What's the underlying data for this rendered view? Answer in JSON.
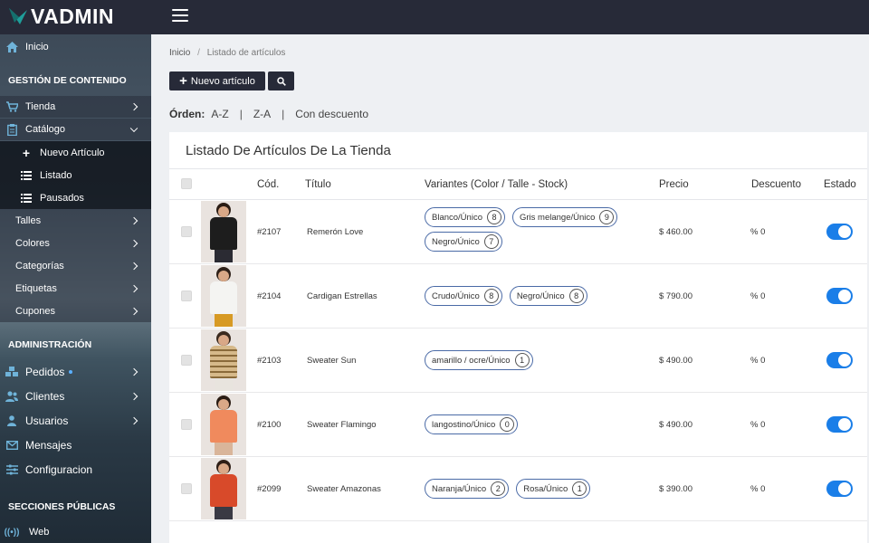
{
  "brand": {
    "name": "VADMIN",
    "accent": "#1f9e9a"
  },
  "topbar": {
    "menu_icon": "hamburger-icon"
  },
  "sidebar": {
    "inicio": "Inicio",
    "sections": {
      "contenido": "GESTIÓN DE CONTENIDO",
      "administracion": "ADMINISTRACIÓN",
      "publicas": "SECCIONES PÚBLICAS"
    },
    "tienda": "Tienda",
    "catalogo": "Catálogo",
    "catalogo_sub": [
      "Nuevo Artículo",
      "Listado",
      "Pausados"
    ],
    "tienda_items": [
      "Talles",
      "Colores",
      "Categorías",
      "Etiquetas",
      "Cupones"
    ],
    "admin_items": [
      "Pedidos",
      "Clientes",
      "Usuarios",
      "Mensajes",
      "Configuracion"
    ],
    "web": "Web"
  },
  "breadcrumb": {
    "home": "Inicio",
    "separator": "/",
    "current": "Listado de artículos"
  },
  "toolbar": {
    "new_label": "Nuevo artículo"
  },
  "order": {
    "label": "Órden:",
    "options": [
      "A-Z",
      "Z-A",
      "Con descuento"
    ]
  },
  "card": {
    "title": "Listado De Artículos De La Tienda"
  },
  "table": {
    "headers": [
      "Cód.",
      "Título",
      "Variantes (Color / Talle - Stock)",
      "Precio",
      "Descuento",
      "Estado"
    ],
    "rows": [
      {
        "code": "#2107",
        "title": "Remerón Love",
        "variants": [
          [
            "Blanco/Único",
            "8"
          ],
          [
            "Gris melange/Único",
            "9"
          ],
          [
            "Negro/Único",
            "7"
          ]
        ],
        "price": "$ 460.00",
        "discount": "% 0",
        "active": true
      },
      {
        "code": "#2104",
        "title": "Cardigan Estrellas",
        "variants": [
          [
            "Crudo/Único",
            "8"
          ],
          [
            "Negro/Único",
            "8"
          ]
        ],
        "price": "$ 790.00",
        "discount": "% 0",
        "active": true
      },
      {
        "code": "#2103",
        "title": "Sweater Sun",
        "variants": [
          [
            "amarillo / ocre/Único",
            "1"
          ]
        ],
        "price": "$ 490.00",
        "discount": "% 0",
        "active": true
      },
      {
        "code": "#2100",
        "title": "Sweater Flamingo",
        "variants": [
          [
            "langostino/Único",
            "0"
          ]
        ],
        "price": "$ 490.00",
        "discount": "% 0",
        "active": true
      },
      {
        "code": "#2099",
        "title": "Sweater Amazonas",
        "variants": [
          [
            "Naranja/Único",
            "2"
          ],
          [
            "Rosa/Único",
            "1"
          ]
        ],
        "price": "$ 390.00",
        "discount": "% 0",
        "active": true
      }
    ]
  }
}
